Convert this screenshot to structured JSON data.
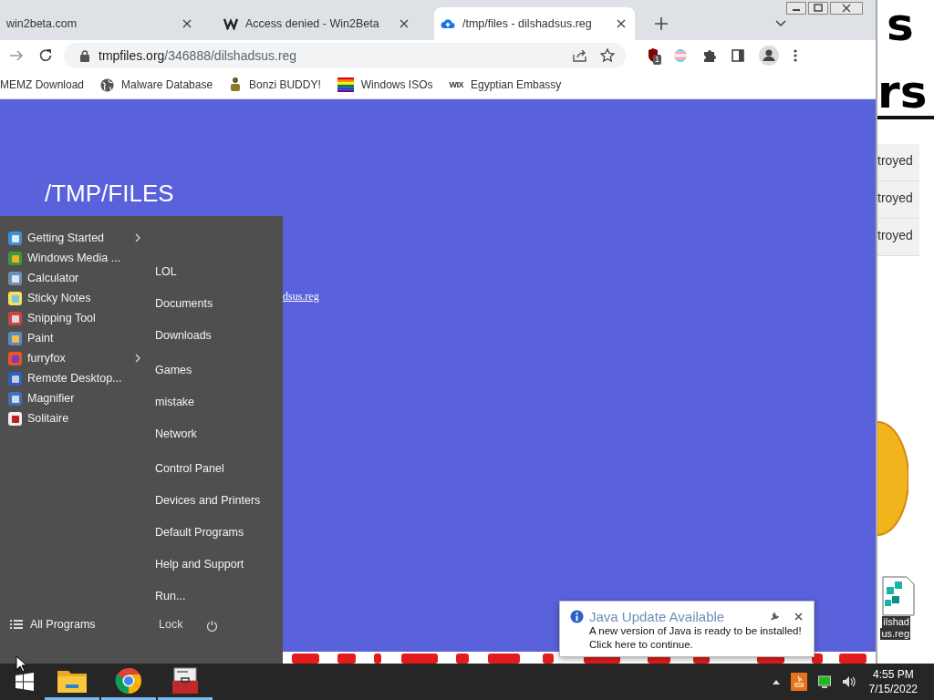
{
  "browser": {
    "tabs": [
      {
        "title": "win2beta.com",
        "kind": "plain",
        "selected": false
      },
      {
        "title": "Access denied - Win2Beta",
        "kind": "wlogo",
        "selected": false
      },
      {
        "title": "/tmp/files - dilshadsus.reg",
        "kind": "cloud",
        "selected": true
      }
    ],
    "address": {
      "host": "tmpfiles.org",
      "path": "/346888/dilshadsus.reg"
    },
    "extension_badge": "1",
    "bookmarks": [
      {
        "label": "MEMZ Download",
        "kind": "plain"
      },
      {
        "label": "Malware Database",
        "kind": "globe"
      },
      {
        "label": "Bonzi BUDDY!",
        "kind": "figure"
      },
      {
        "label": "Windows ISOs",
        "kind": "rainbow"
      },
      {
        "label": "Egyptian Embassy",
        "kind": "wordmark",
        "icon_text": "WIX"
      }
    ],
    "page": {
      "title": "/TMP/FILES",
      "link": "dsus.reg"
    }
  },
  "background_page": {
    "heading_parts": [
      "s",
      "rs"
    ],
    "rows": [
      "troyed",
      "troyed",
      "troyed"
    ],
    "file_label": [
      "ilshad",
      "us.reg"
    ]
  },
  "start_menu": {
    "programs": [
      {
        "label": "Getting Started",
        "kind": "doc",
        "submenu": true
      },
      {
        "label": "Windows Media ...",
        "kind": "media",
        "submenu": false
      },
      {
        "label": "Calculator",
        "kind": "calc",
        "submenu": false
      },
      {
        "label": "Sticky Notes",
        "kind": "notes",
        "submenu": false
      },
      {
        "label": "Snipping Tool",
        "kind": "snip",
        "submenu": false
      },
      {
        "label": "Paint",
        "kind": "paint",
        "submenu": false
      },
      {
        "label": "furryfox",
        "kind": "fox",
        "submenu": true
      },
      {
        "label": "Remote Desktop...",
        "kind": "remote",
        "submenu": false
      },
      {
        "label": "Magnifier",
        "kind": "magnifier",
        "submenu": false
      },
      {
        "label": "Solitaire",
        "kind": "cards",
        "submenu": false
      }
    ],
    "places": [
      "LOL",
      "Documents",
      "Downloads",
      "Games",
      "mistake",
      "Network",
      "Control Panel",
      "Devices and Printers",
      "Default Programs",
      "Help and Support",
      "Run..."
    ],
    "all_programs": "All Programs",
    "lock": "Lock"
  },
  "notification": {
    "title": "Java Update Available",
    "lines": [
      "A new version of Java is ready to be installed!",
      "Click here to continue."
    ]
  },
  "taskbar": {
    "apps": [
      {
        "kind": "folder",
        "running": true
      },
      {
        "kind": "chrome",
        "running": true
      },
      {
        "kind": "toolbox",
        "running": true
      }
    ],
    "clock": {
      "time": "4:55 PM",
      "date": "7/15/2022"
    }
  }
}
